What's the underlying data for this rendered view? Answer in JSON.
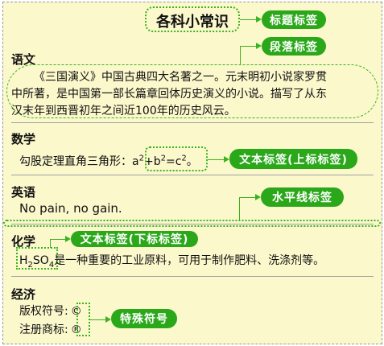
{
  "title": "各科小常识",
  "labels": {
    "title_tag": "标题标签",
    "paragraph_tag": "段落标签",
    "sup_tag": "文本标签(上标标签)",
    "hr_tag": "水平线标签",
    "sub_tag": "文本标签(下标标签)",
    "special_tag": "特殊符号"
  },
  "chinese": {
    "heading": "语文",
    "lines": [
      "《三国演义》中国古典四大名著之一。元末明初小说家罗贯",
      "中所著，是中国第一部长篇章回体历史演义的小说。描写了从东",
      "汉末年到西晋初年之间近100年的历史风云。"
    ]
  },
  "math": {
    "heading": "数学",
    "prefix": "勾股定理直角三角形：",
    "a": "a",
    "b": "b",
    "c": "c",
    "exp": "2",
    "plus": "+",
    "eq": "=",
    "suffix": "。"
  },
  "english": {
    "heading": "英语",
    "text": "No pain, no gain."
  },
  "chemistry": {
    "heading": "化学",
    "h": "H",
    "h_sub": "2",
    "so": "SO",
    "so_sub": "4",
    "text": "是一种重要的工业原料，可用于制作肥料、洗涤剂等。"
  },
  "economy": {
    "heading": "经济",
    "copyright_label": "版权符号:",
    "copyright": "©",
    "trademark_label": "注册商标:",
    "trademark": "®"
  },
  "colors": {
    "tag": "#2aa81a",
    "background": "#fbf8cc"
  }
}
